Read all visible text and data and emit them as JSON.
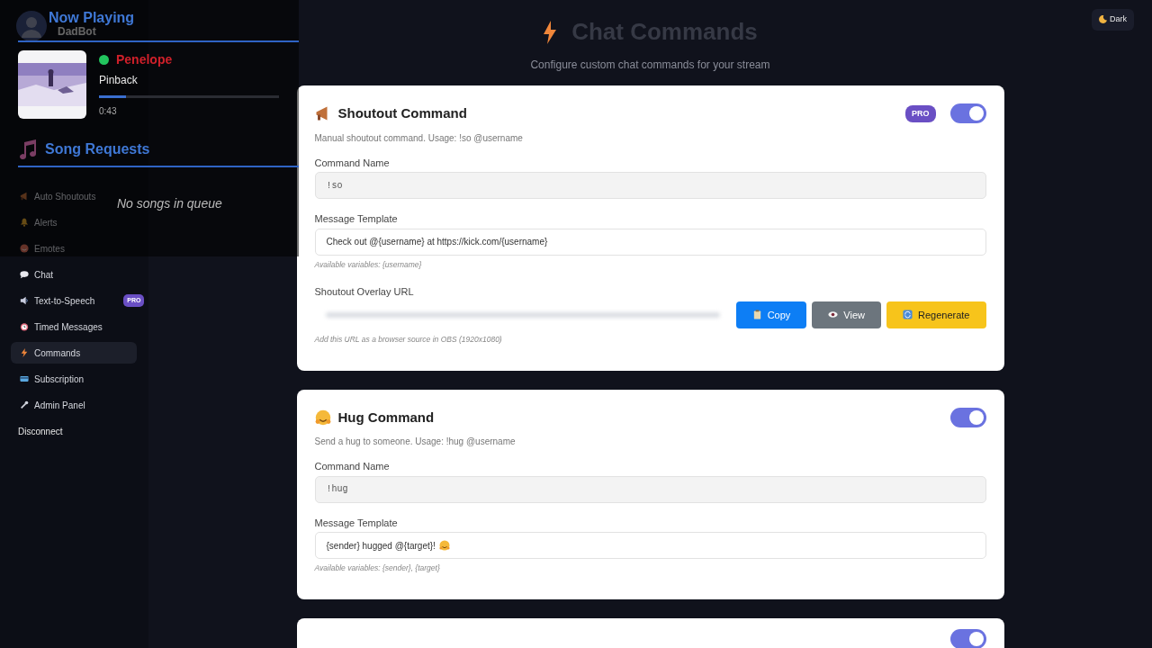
{
  "sidebar": {
    "brand": "DadBot",
    "items": [
      {
        "label": "Auto Shoutouts",
        "selected": false
      },
      {
        "label": "Alerts",
        "selected": false
      },
      {
        "label": "Emotes",
        "selected": false
      },
      {
        "label": "Chat",
        "selected": false
      },
      {
        "label": "Text-to-Speech",
        "badge": "PRO",
        "selected": false
      },
      {
        "label": "Timed Messages",
        "selected": false
      },
      {
        "label": "Commands",
        "selected": true
      },
      {
        "label": "Subscription",
        "selected": false
      },
      {
        "label": "Admin Panel",
        "selected": false
      }
    ],
    "disconnect": "Disconnect"
  },
  "now_playing": {
    "title": "Now Playing",
    "playing": true,
    "track": "Penelope",
    "artist": "Pinback",
    "progress": {
      "level": 0.15
    },
    "elapsed": "0:43"
  },
  "song_requests": {
    "title": "Song Requests",
    "empty_text": "No songs in queue"
  },
  "header": {
    "title": "Chat Commands",
    "subtitle": "Configure custom chat commands for your stream",
    "theme_button": "Dark"
  },
  "commands": [
    {
      "title": "Shoutout Command",
      "badge": "PRO",
      "enabled": true,
      "description": "Manual shoutout command. Usage: !so @username",
      "fields": [
        {
          "label": "Command Name",
          "value": "!so",
          "readonly": true
        },
        {
          "label": "Message Template",
          "value": "Check out @{username} at https://kick.com/{username}",
          "readonly": false
        }
      ],
      "hint": "Available variables: {username}",
      "overlay": {
        "label": "Shoutout Overlay URL",
        "buttons": [
          {
            "label": "Copy",
            "kind": "primary"
          },
          {
            "label": "View",
            "kind": "secondary"
          },
          {
            "label": "Regenerate",
            "kind": "warning"
          }
        ],
        "hint": "Add this URL as a browser source in OBS (1920x1080)"
      }
    },
    {
      "title": "Hug Command",
      "enabled": true,
      "description": "Send a hug to someone. Usage: !hug @username",
      "fields": [
        {
          "label": "Command Name",
          "value": "!hug",
          "readonly": true
        },
        {
          "label": "Message Template",
          "value": "{sender} hugged @{target}!",
          "readonly": false,
          "trailing_icon": true
        }
      ],
      "hint": "Available variables: {sender}, {target}"
    },
    {
      "enabled": true
    }
  ]
}
